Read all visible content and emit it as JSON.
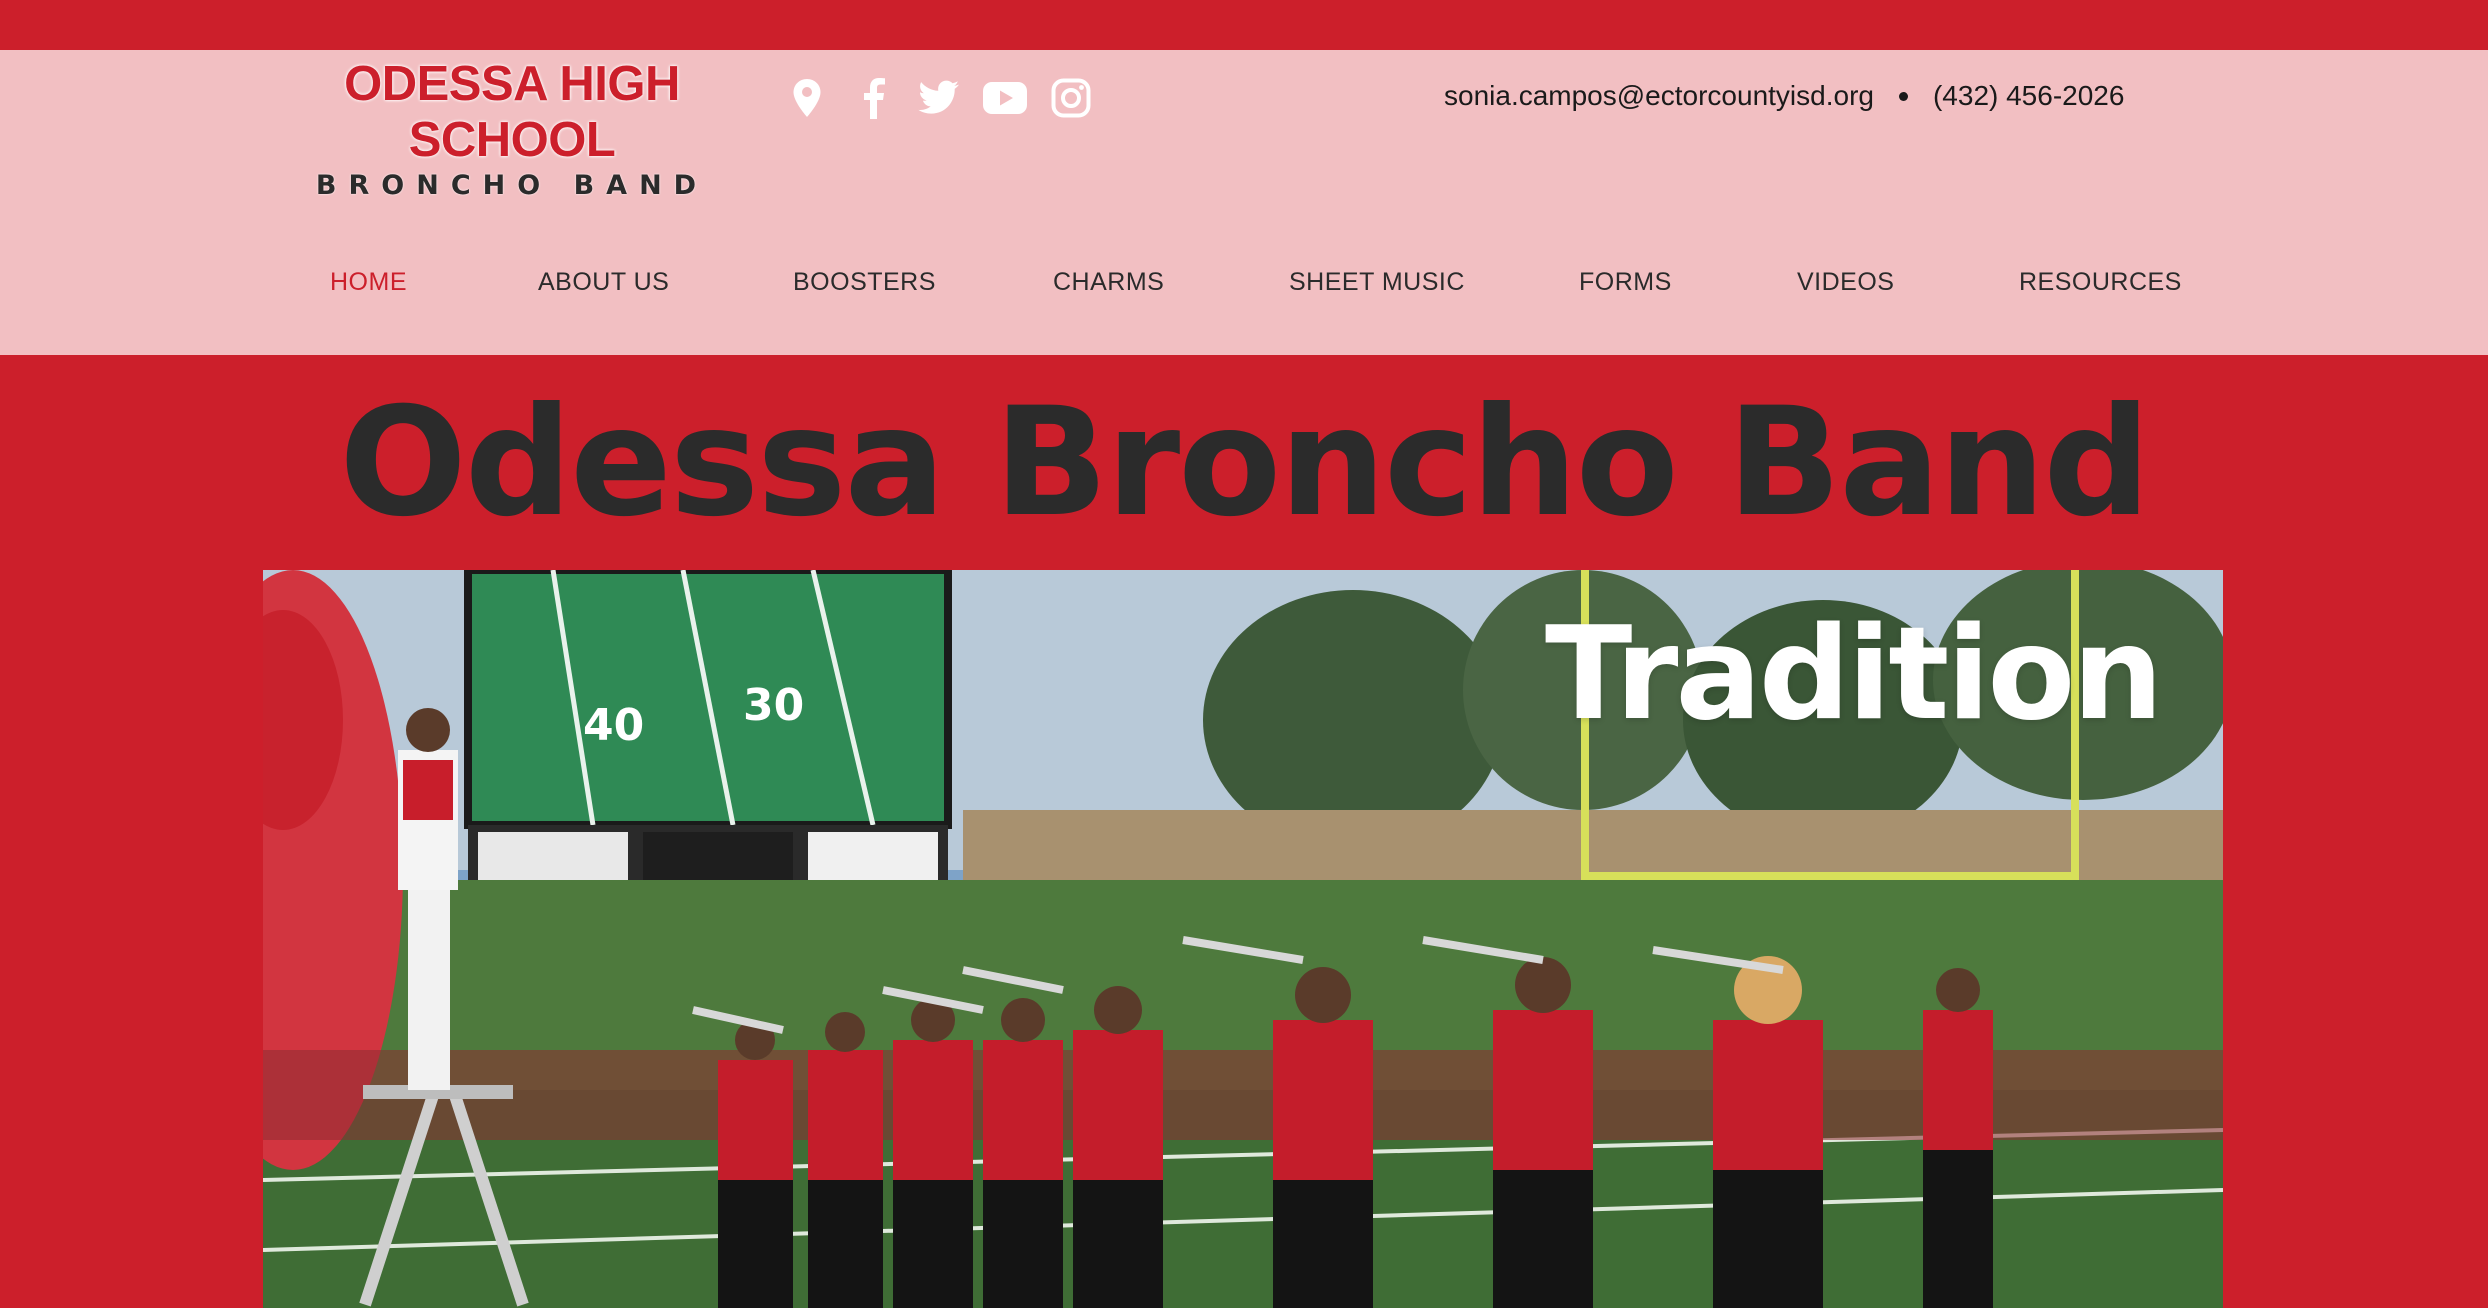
{
  "logo": {
    "line1": "ODESSA HIGH SCHOOL",
    "line2": "BRONCHO BAND"
  },
  "social_icons": [
    "map-pin-icon",
    "facebook-icon",
    "twitter-icon",
    "youtube-icon",
    "instagram-icon"
  ],
  "contact": {
    "email": "sonia.campos@ectorcountyisd.org",
    "phone": "(432) 456-2026"
  },
  "nav": {
    "items": [
      {
        "label": "HOME",
        "active": true
      },
      {
        "label": "ABOUT US"
      },
      {
        "label": "BOOSTERS"
      },
      {
        "label": "CHARMS"
      },
      {
        "label": "SHEET MUSIC"
      },
      {
        "label": "FORMS"
      },
      {
        "label": "VIDEOS"
      },
      {
        "label": "RESOURCES"
      }
    ]
  },
  "hero": {
    "title": "Odessa Broncho Band",
    "image_caption": "Tradition"
  },
  "colors": {
    "brand_red": "#cc1f2b",
    "header_pink": "#f2bfc2",
    "text_dark": "#2b2b2b"
  }
}
